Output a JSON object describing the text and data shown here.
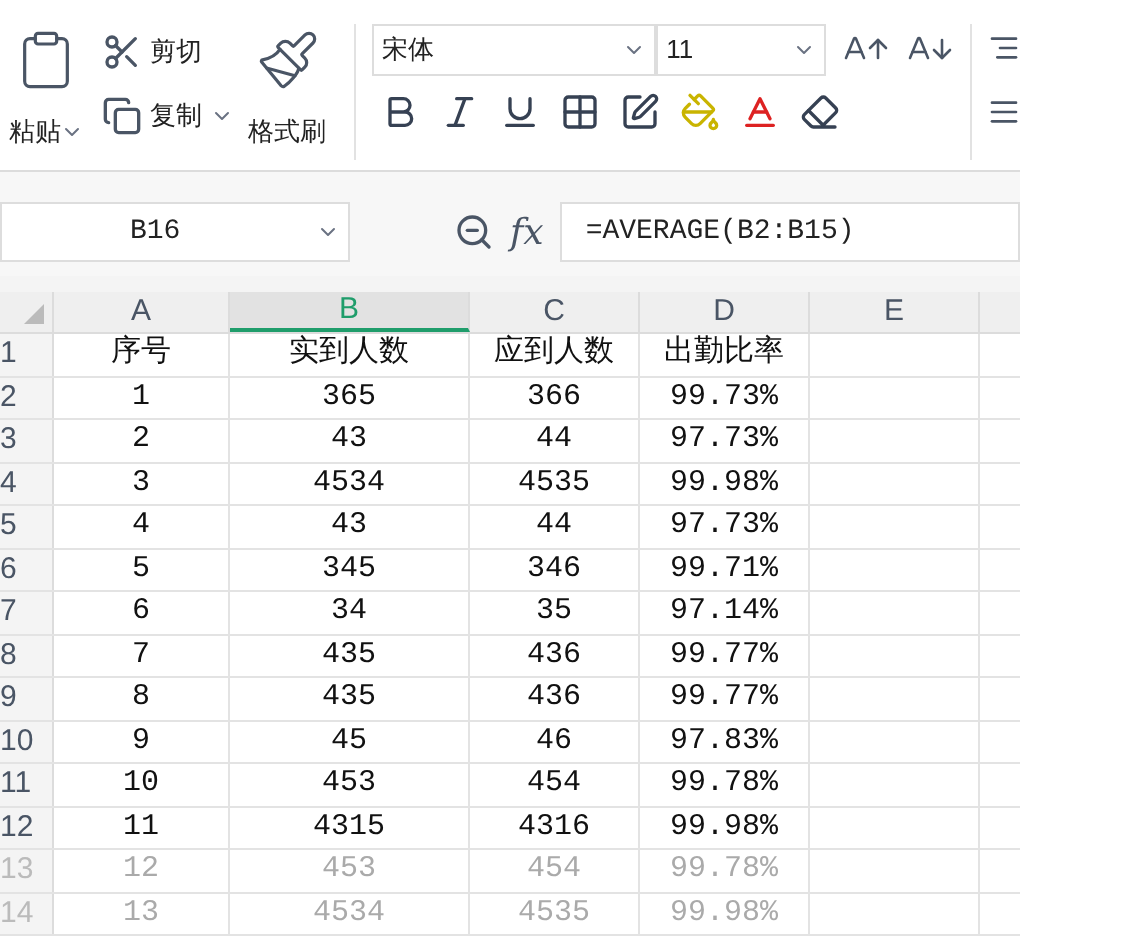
{
  "toolbar": {
    "paste": "粘贴",
    "cut": "剪切",
    "copy": "复制",
    "format_painter": "格式刷",
    "font_name": "宋体",
    "font_size": "11"
  },
  "formula_bar": {
    "name_box": "B16",
    "function_label": "fx",
    "formula": "=AVERAGE(B2:B15)"
  },
  "sheet": {
    "columns": [
      {
        "label": "A",
        "selected": false
      },
      {
        "label": "B",
        "selected": true
      },
      {
        "label": "C",
        "selected": false
      },
      {
        "label": "D",
        "selected": false
      },
      {
        "label": "E",
        "selected": false
      }
    ],
    "rows": [
      {
        "number": "1",
        "faded": false,
        "cells": [
          "序号",
          "实到人数",
          "应到人数",
          "出勤比率"
        ]
      },
      {
        "number": "2",
        "faded": false,
        "cells": [
          "1",
          "365",
          "366",
          "99.73%"
        ]
      },
      {
        "number": "3",
        "faded": false,
        "cells": [
          "2",
          "43",
          "44",
          "97.73%"
        ]
      },
      {
        "number": "4",
        "faded": false,
        "cells": [
          "3",
          "4534",
          "4535",
          "99.98%"
        ]
      },
      {
        "number": "5",
        "faded": false,
        "cells": [
          "4",
          "43",
          "44",
          "97.73%"
        ]
      },
      {
        "number": "6",
        "faded": false,
        "cells": [
          "5",
          "345",
          "346",
          "99.71%"
        ]
      },
      {
        "number": "7",
        "faded": false,
        "cells": [
          "6",
          "34",
          "35",
          "97.14%"
        ]
      },
      {
        "number": "8",
        "faded": false,
        "cells": [
          "7",
          "435",
          "436",
          "99.77%"
        ]
      },
      {
        "number": "9",
        "faded": false,
        "cells": [
          "8",
          "435",
          "436",
          "99.77%"
        ]
      },
      {
        "number": "10",
        "faded": false,
        "cells": [
          "9",
          "45",
          "46",
          "97.83%"
        ]
      },
      {
        "number": "11",
        "faded": false,
        "cells": [
          "10",
          "453",
          "454",
          "99.78%"
        ]
      },
      {
        "number": "12",
        "faded": false,
        "cells": [
          "11",
          "4315",
          "4316",
          "99.98%"
        ]
      },
      {
        "number": "13",
        "faded": true,
        "cells": [
          "12",
          "453",
          "454",
          "99.78%"
        ]
      },
      {
        "number": "14",
        "faded": true,
        "cells": [
          "13",
          "4534",
          "4535",
          "99.98%"
        ]
      }
    ]
  }
}
